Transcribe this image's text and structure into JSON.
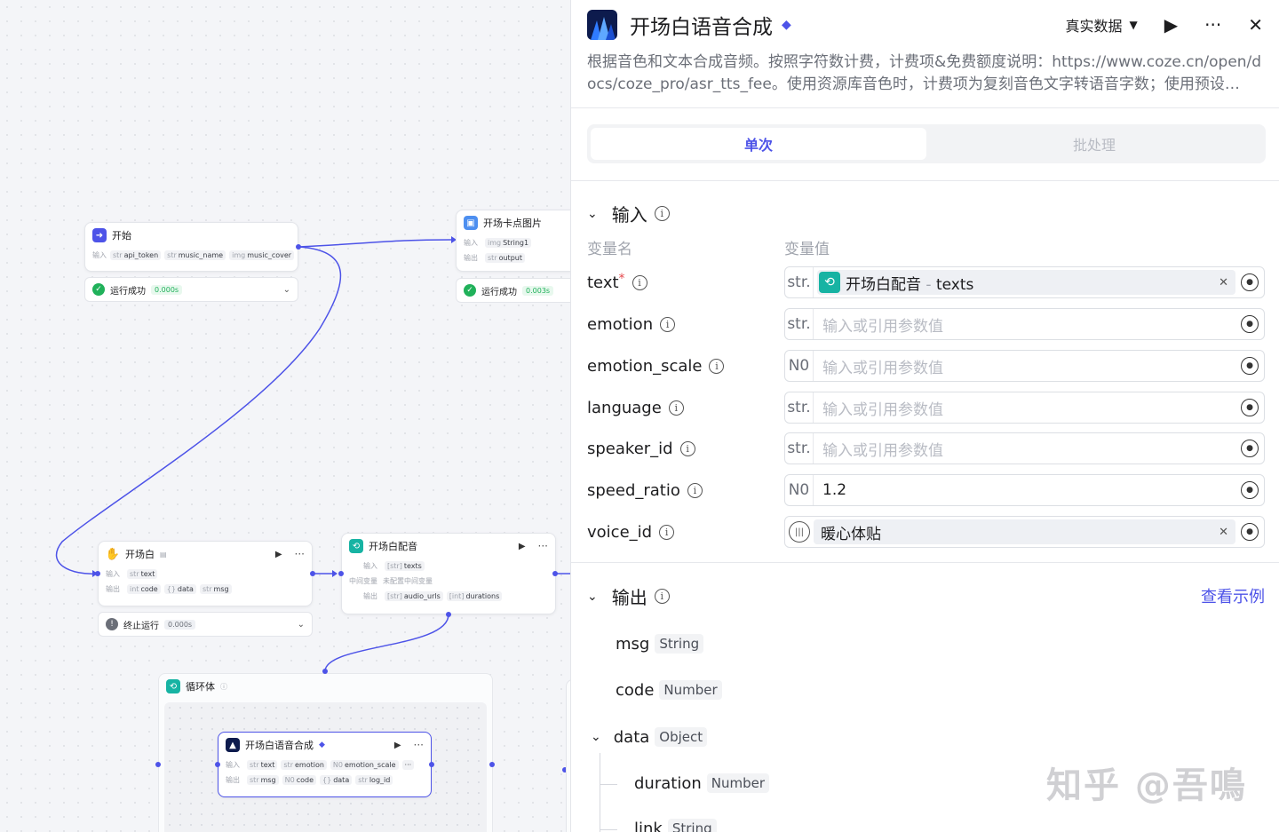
{
  "canvas": {
    "start_node": {
      "title": "开始",
      "row_label": "输入",
      "fields": [
        {
          "type": "str",
          "name": "api_token"
        },
        {
          "type": "str",
          "name": "music_name"
        },
        {
          "type": "img",
          "name": "music_cover"
        }
      ],
      "status": "运行成功",
      "time": "0.000s"
    },
    "card_image_node": {
      "title": "开场卡点图片",
      "in_label": "输入",
      "in_field": {
        "type": "img",
        "name": "String1"
      },
      "out_label": "输出",
      "out_field": {
        "type": "str",
        "name": "output"
      },
      "status": "运行成功",
      "time": "0.003s"
    },
    "opening_node": {
      "title": "开场白",
      "in_label": "输入",
      "in_field": {
        "type": "str",
        "name": "text"
      },
      "out_label": "输出",
      "out_fields": [
        {
          "type": "int",
          "name": "code"
        },
        {
          "type": "{}",
          "name": "data"
        },
        {
          "type": "str",
          "name": "msg"
        }
      ],
      "status": "终止运行",
      "time": "0.000s"
    },
    "dubbing_node": {
      "title": "开场白配音",
      "in_label": "输入",
      "in_field": {
        "type": "[str]",
        "name": "texts"
      },
      "mid_label": "中间变量",
      "mid_value": "未配置中间变量",
      "out_label": "输出",
      "out_fields": [
        {
          "type": "[str]",
          "name": "audio_urls"
        },
        {
          "type": "[int]",
          "name": "durations"
        }
      ]
    },
    "loop_node": {
      "title": "循环体"
    },
    "tts_node": {
      "title": "开场白语音合成",
      "in_label": "输入",
      "in_fields": [
        {
          "type": "str",
          "name": "text"
        },
        {
          "type": "str",
          "name": "emotion"
        },
        {
          "type": "N0",
          "name": "emotion_scale"
        }
      ],
      "out_label": "输出",
      "out_fields": [
        {
          "type": "str",
          "name": "msg"
        },
        {
          "type": "N0",
          "name": "code"
        },
        {
          "type": "{}",
          "name": "data"
        },
        {
          "type": "str",
          "name": "log_id"
        }
      ]
    }
  },
  "panel": {
    "title": "开场白语音合成",
    "mode_label": "真实数据",
    "description": "根据音色和文本合成音频。按照字符数计费，计费项&免费额度说明：https://www.coze.cn/open/docs/coze_pro/asr_tts_fee。使用资源库音色时，计费项为复刻音色文字转语音字数；使用预设…",
    "tabs": [
      "单次",
      "批处理"
    ],
    "input_section": "输入",
    "col_name": "变量名",
    "col_value": "变量值",
    "params": [
      {
        "name": "text",
        "required": "*",
        "type": "str.",
        "ref_node": "开场白配音",
        "ref_sep": " - ",
        "ref_field": "texts"
      },
      {
        "name": "emotion",
        "type": "str.",
        "placeholder": "输入或引用参数值"
      },
      {
        "name": "emotion_scale",
        "type": "N0",
        "placeholder": "输入或引用参数值"
      },
      {
        "name": "language",
        "type": "str.",
        "placeholder": "输入或引用参数值"
      },
      {
        "name": "speaker_id",
        "type": "str.",
        "placeholder": "输入或引用参数值"
      },
      {
        "name": "speed_ratio",
        "type": "N0",
        "value": "1.2"
      },
      {
        "name": "voice_id",
        "voice": "暖心体贴"
      }
    ],
    "output_section": "输出",
    "see_example": "查看示例",
    "outputs": [
      {
        "name": "msg",
        "type": "String"
      },
      {
        "name": "code",
        "type": "Number"
      },
      {
        "name": "data",
        "type": "Object"
      },
      {
        "name": "duration",
        "type": "Number"
      },
      {
        "name": "link",
        "type": "String"
      }
    ]
  },
  "watermark": "知乎 @吾鳴",
  "colors": {
    "accent": "#4d53e8",
    "success": "#20b15a",
    "teal": "#17b3a3"
  }
}
